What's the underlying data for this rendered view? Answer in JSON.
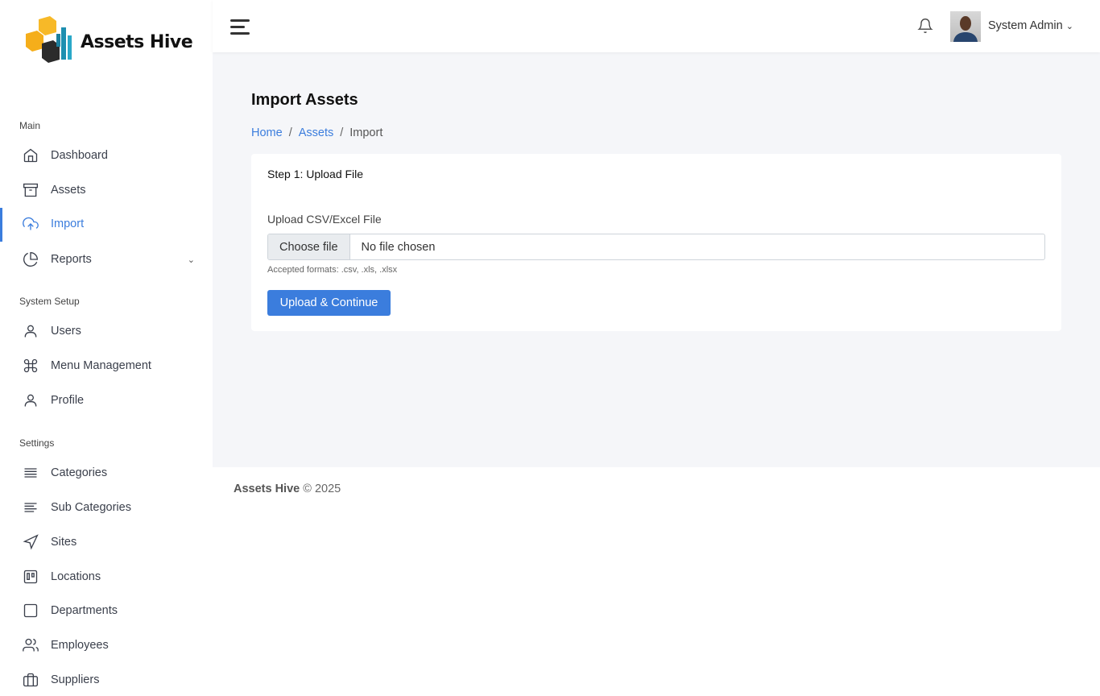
{
  "brand": {
    "name": "Assets Hive"
  },
  "sidebar": {
    "sections": [
      "Main",
      "System Setup",
      "Settings"
    ],
    "items": [
      {
        "label": "Dashboard",
        "icon": "home-icon"
      },
      {
        "label": "Assets",
        "icon": "archive-icon"
      },
      {
        "label": "Import",
        "icon": "upload-cloud-icon",
        "active": true
      },
      {
        "label": "Reports",
        "icon": "pie-chart-icon"
      },
      {
        "label": "Users",
        "icon": "user-icon"
      },
      {
        "label": "Menu Management",
        "icon": "command-icon"
      },
      {
        "label": "Profile",
        "icon": "user-icon"
      },
      {
        "label": "Categories",
        "icon": "list-icon"
      },
      {
        "label": "Sub Categories",
        "icon": "align-left-icon"
      },
      {
        "label": "Sites",
        "icon": "navigation-icon"
      },
      {
        "label": "Locations",
        "icon": "trello-icon"
      },
      {
        "label": "Departments",
        "icon": "square-icon"
      },
      {
        "label": "Employees",
        "icon": "users-icon"
      },
      {
        "label": "Suppliers",
        "icon": "briefcase-icon"
      }
    ]
  },
  "header": {
    "user_name": "System Admin"
  },
  "page": {
    "title": "Import Assets",
    "breadcrumb": [
      "Home",
      "Assets",
      "Import"
    ],
    "sep": "/"
  },
  "card": {
    "title": "Step 1: Upload File",
    "field_label": "Upload CSV/Excel File",
    "choose_label": "Choose file",
    "file_status": "No file chosen",
    "hint": "Accepted formats: .csv, .xls, .xlsx",
    "submit_label": "Upload & Continue"
  },
  "footer": {
    "brand": "Assets Hive",
    "copy": "© 2025"
  },
  "colors": {
    "accent": "#3b7ddd",
    "bg": "#f5f6f9"
  }
}
